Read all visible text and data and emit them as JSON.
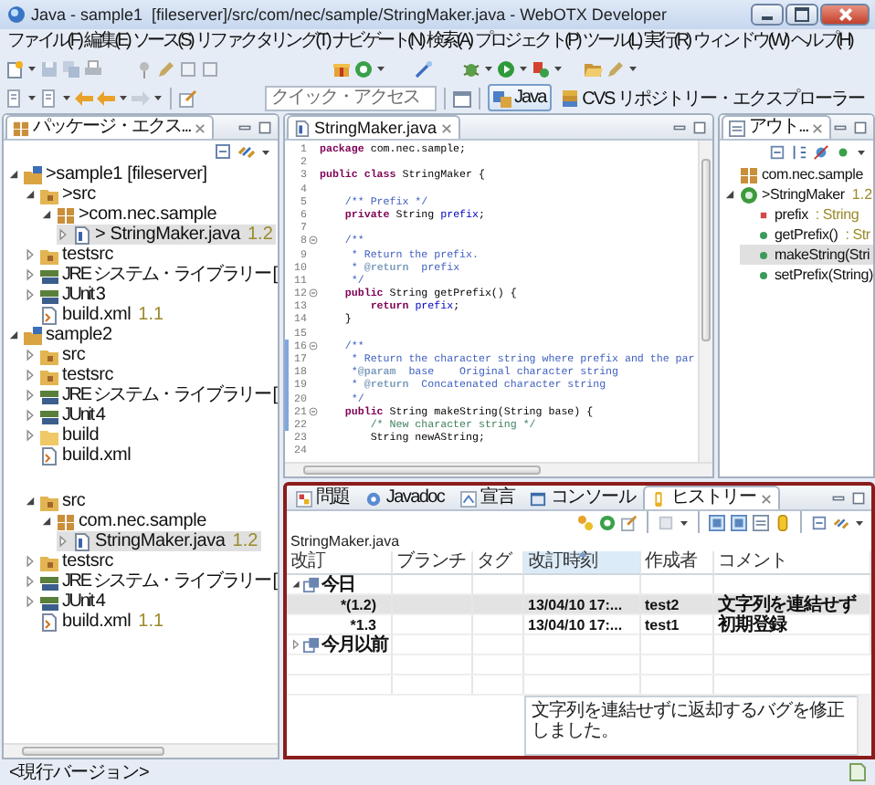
{
  "window": {
    "title": "Java - sample1  [fileserver]/src/com/nec/sample/StringMaker.java - WebOTX Developer"
  },
  "menu": [
    "ファイル(F)",
    "編集(E)",
    "ソース(S)",
    "リファクタリング(T)",
    "ナビゲート(N)",
    "検索(A)",
    "プロジェクト(P)",
    "ツール(L)",
    "実行(R)",
    "ウィンドウ(W)",
    "ヘルプ(H)"
  ],
  "quick_access": {
    "placeholder": "クイック・アクセス"
  },
  "perspectives": [
    {
      "label": "Java",
      "selected": true
    },
    {
      "label": "CVS リポジトリー・エクスプローラー",
      "selected": false
    }
  ],
  "package_explorer": {
    "title": "パッケージ・エクス...",
    "tree": [
      {
        "kind": "project",
        "label": ">sample1  [fileserver]",
        "expanded": true,
        "selected": false,
        "children": [
          {
            "kind": "source-folder",
            "label": ">src",
            "expanded": true,
            "selected": false,
            "children": [
              {
                "kind": "package",
                "label": ">com.nec.sample",
                "expanded": true,
                "selected": false,
                "children": [
                  {
                    "kind": "java-file",
                    "label": "> StringMaker.java",
                    "revision": "1.2",
                    "expanded": false,
                    "selected": true
                  }
                ]
              }
            ]
          },
          {
            "kind": "source-folder",
            "label": "testsrc",
            "expanded": false,
            "selected": false
          },
          {
            "kind": "library",
            "label": "JRE システム・ライブラリー [",
            "expanded": false,
            "selected": false
          },
          {
            "kind": "library",
            "label": "JUnit 3",
            "expanded": false,
            "selected": false
          },
          {
            "kind": "xml-file",
            "label": "build.xml",
            "revision": "1.1",
            "selected": false
          }
        ]
      },
      {
        "kind": "project",
        "label": "sample2",
        "expanded": true,
        "selected": false,
        "children": [
          {
            "kind": "source-folder",
            "label": "src",
            "expanded": false,
            "selected": false
          },
          {
            "kind": "source-folder",
            "label": "testsrc",
            "expanded": false,
            "selected": false
          },
          {
            "kind": "library",
            "label": "JRE システム・ライブラリー [",
            "expanded": false,
            "selected": false
          },
          {
            "kind": "library",
            "label": "JUnit 4",
            "expanded": false,
            "selected": false
          },
          {
            "kind": "folder",
            "label": "build",
            "expanded": false,
            "selected": false
          },
          {
            "kind": "xml-file",
            "label": "build.xml",
            "selected": false
          }
        ]
      }
    ],
    "tree_fragment": [
      {
        "kind": "source-folder",
        "label": "src",
        "expanded": true,
        "selected": false,
        "children": [
          {
            "kind": "package",
            "label": "com.nec.sample",
            "expanded": true,
            "selected": false,
            "children": [
              {
                "kind": "java-file",
                "label": "StringMaker.java",
                "revision": "1.2",
                "expanded": false,
                "selected": true
              }
            ]
          }
        ]
      },
      {
        "kind": "source-folder",
        "label": "testsrc",
        "expanded": false,
        "selected": false
      },
      {
        "kind": "library",
        "label": "JRE システム・ライブラリー [",
        "expanded": false,
        "selected": false
      },
      {
        "kind": "library",
        "label": "JUnit 4",
        "expanded": false,
        "selected": false
      },
      {
        "kind": "xml-file",
        "label": "build.xml",
        "revision": "1.1",
        "selected": false
      }
    ]
  },
  "editor": {
    "tab": "StringMaker.java",
    "lines": [
      {
        "number": "1",
        "fold": false,
        "changed": false,
        "tokens": [
          {
            "kind": "keyword",
            "text": "package"
          },
          {
            "kind": "plain",
            "text": " com.nec.sample;"
          }
        ]
      },
      {
        "number": "2",
        "fold": false,
        "changed": false
      },
      {
        "number": "3",
        "fold": false,
        "changed": false,
        "tokens": [
          {
            "kind": "keyword",
            "text": "public class"
          },
          {
            "kind": "plain",
            "text": " StringMaker {"
          }
        ]
      },
      {
        "number": "4",
        "fold": false,
        "changed": false
      },
      {
        "number": "5",
        "fold": false,
        "changed": false,
        "tokens": [
          {
            "kind": "javadoc",
            "text": "    /** Prefix */"
          }
        ]
      },
      {
        "number": "6",
        "fold": false,
        "changed": false,
        "tokens": [
          {
            "kind": "keyword",
            "text": "    private"
          },
          {
            "kind": "plain",
            "text": " String "
          },
          {
            "kind": "field",
            "text": "prefix"
          },
          {
            "kind": "plain",
            "text": ";"
          }
        ]
      },
      {
        "number": "7",
        "fold": false,
        "changed": false
      },
      {
        "number": "8",
        "fold": true,
        "changed": false,
        "tokens": [
          {
            "kind": "javadoc",
            "text": "    /**"
          }
        ]
      },
      {
        "number": "9",
        "fold": false,
        "changed": false,
        "tokens": [
          {
            "kind": "javadoc",
            "text": "     * Return the prefix."
          }
        ]
      },
      {
        "number": "10",
        "fold": false,
        "changed": false,
        "tokens": [
          {
            "kind": "javadoc",
            "text": "     * "
          },
          {
            "kind": "tag",
            "text": "@return"
          },
          {
            "kind": "javadoc",
            "text": "  prefix"
          }
        ]
      },
      {
        "number": "11",
        "fold": false,
        "changed": false,
        "tokens": [
          {
            "kind": "javadoc",
            "text": "     */"
          }
        ]
      },
      {
        "number": "12",
        "fold": true,
        "changed": false,
        "tokens": [
          {
            "kind": "keyword",
            "text": "    public"
          },
          {
            "kind": "plain",
            "text": " String getPrefix() {"
          }
        ]
      },
      {
        "number": "13",
        "fold": false,
        "changed": false,
        "tokens": [
          {
            "kind": "keyword",
            "text": "        return "
          },
          {
            "kind": "field",
            "text": "prefix"
          },
          {
            "kind": "plain",
            "text": ";"
          }
        ]
      },
      {
        "number": "14",
        "fold": false,
        "changed": false,
        "tokens": [
          {
            "kind": "plain",
            "text": "    }"
          }
        ]
      },
      {
        "number": "15",
        "fold": false,
        "changed": false
      },
      {
        "number": "16",
        "fold": true,
        "changed": true,
        "tokens": [
          {
            "kind": "javadoc",
            "text": "    /**"
          }
        ]
      },
      {
        "number": "17",
        "fold": false,
        "changed": true,
        "tokens": [
          {
            "kind": "javadoc",
            "text": "     * Return the character string where prefix and the par"
          }
        ]
      },
      {
        "number": "18",
        "fold": false,
        "changed": true,
        "tokens": [
          {
            "kind": "javadoc",
            "text": "     *"
          },
          {
            "kind": "tag",
            "text": "@param"
          },
          {
            "kind": "javadoc",
            "text": "  base    Original character string"
          }
        ]
      },
      {
        "number": "19",
        "fold": false,
        "changed": true,
        "tokens": [
          {
            "kind": "javadoc",
            "text": "     * "
          },
          {
            "kind": "tag",
            "text": "@return"
          },
          {
            "kind": "javadoc",
            "text": "  Concatenated character string"
          }
        ]
      },
      {
        "number": "20",
        "fold": false,
        "changed": true,
        "tokens": [
          {
            "kind": "javadoc",
            "text": "     */"
          }
        ]
      },
      {
        "number": "21",
        "fold": true,
        "changed": true,
        "tokens": [
          {
            "kind": "keyword",
            "text": "    public"
          },
          {
            "kind": "plain",
            "text": " String makeString(String base) {"
          }
        ]
      },
      {
        "number": "22",
        "fold": false,
        "changed": true,
        "tokens": [
          {
            "kind": "comment",
            "text": "        /* New character string */"
          }
        ]
      },
      {
        "number": "23",
        "fold": false,
        "changed": false,
        "tokens": [
          {
            "kind": "plain",
            "text": "        String newAString;"
          }
        ]
      },
      {
        "number": "24",
        "fold": false,
        "changed": false
      }
    ]
  },
  "outline": {
    "title": "アウト...",
    "items": [
      {
        "kind": "package",
        "label": "com.nec.sample",
        "selected": false
      },
      {
        "kind": "class",
        "label": ">StringMaker",
        "revision": "1.2",
        "expanded": true,
        "selected": false,
        "children": [
          {
            "kind": "field",
            "label": "prefix",
            "type": ": String",
            "selected": false
          },
          {
            "kind": "method",
            "label": "getPrefix()",
            "type": ": Str",
            "selected": false
          },
          {
            "kind": "method",
            "label": "makeString(Stri",
            "selected": true
          },
          {
            "kind": "method",
            "label": "setPrefix(String)",
            "selected": false
          }
        ]
      }
    ]
  },
  "history": {
    "tabs": [
      {
        "label": "問題",
        "selected": false
      },
      {
        "label": "Javadoc",
        "selected": false
      },
      {
        "label": "宣言",
        "selected": false
      },
      {
        "label": "コンソール",
        "selected": false
      },
      {
        "label": "ヒストリー",
        "selected": true
      }
    ],
    "file": "StringMaker.java",
    "columns": [
      {
        "label": "改訂",
        "sorted": false
      },
      {
        "label": "ブランチ",
        "sorted": false
      },
      {
        "label": "タグ",
        "sorted": false
      },
      {
        "label": "改訂時刻",
        "sorted": true
      },
      {
        "label": "作成者",
        "sorted": false
      },
      {
        "label": "コメント",
        "sorted": false
      }
    ],
    "rows": [
      {
        "kind": "group",
        "label": "今日",
        "expanded": true,
        "selected": false
      },
      {
        "kind": "revision",
        "revision": "*(1.2)",
        "time": "13/04/10 17:...",
        "author": "test2",
        "comment": "文字列を連結せず",
        "selected": true
      },
      {
        "kind": "revision",
        "revision": "*1.3",
        "time": "13/04/10 17:...",
        "author": "test1",
        "comment": "初期登録",
        "selected": false
      },
      {
        "kind": "group",
        "label": "今月以前",
        "expanded": false,
        "selected": false
      }
    ],
    "comment": "文字列を連結せずに返却するバグを修正しました。"
  },
  "status_bar": {
    "text": "<現行バージョン>"
  }
}
